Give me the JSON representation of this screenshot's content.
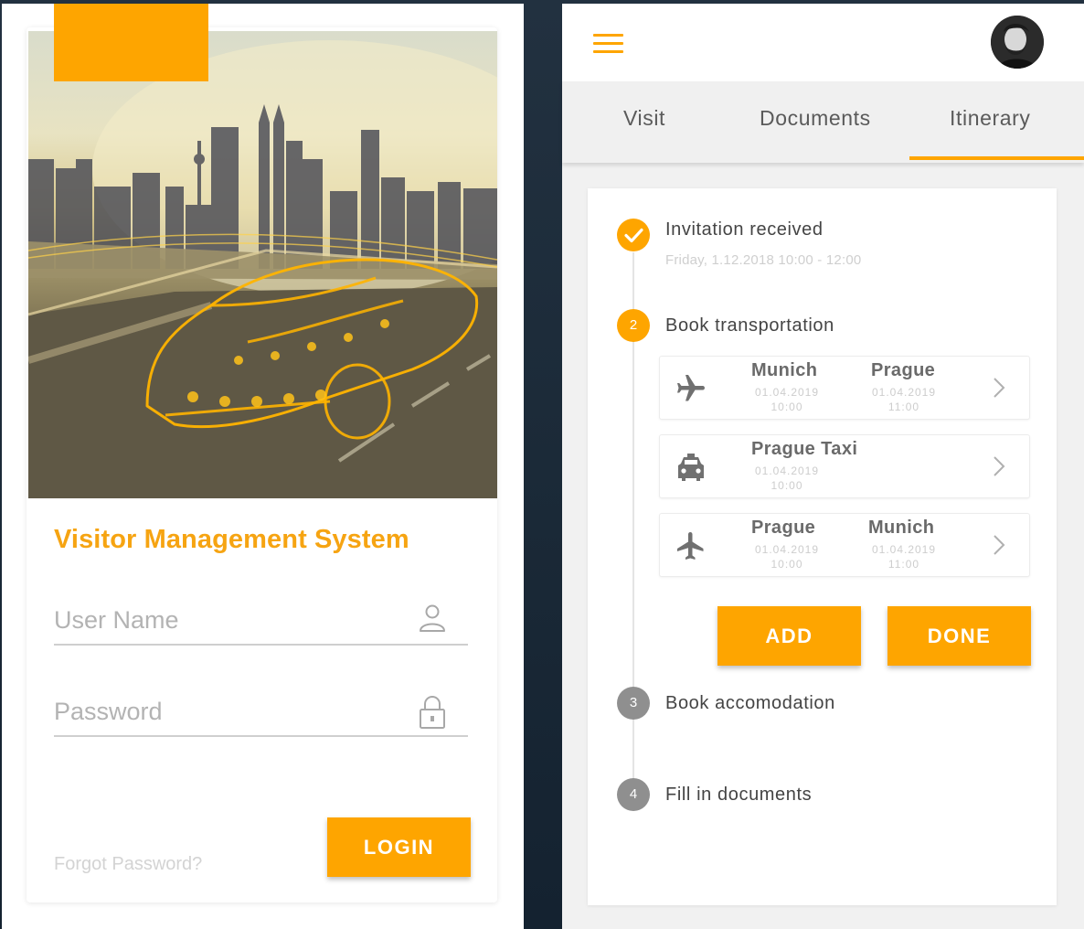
{
  "login": {
    "title": "Visitor Management System",
    "username": {
      "placeholder": "User Name",
      "value": "",
      "icon": "user-icon"
    },
    "password": {
      "placeholder": "Password",
      "value": "",
      "icon": "lock-icon"
    },
    "forgot_label": "Forgot Password?",
    "login_label": "LOGIN",
    "accent_color": "#fea500"
  },
  "itinerary": {
    "menu_icon": "hamburger-menu-icon",
    "avatar": "user-avatar",
    "tabs": [
      {
        "label": "Visit"
      },
      {
        "label": "Documents"
      },
      {
        "label": "Itinerary",
        "active": true
      }
    ],
    "steps": [
      {
        "number": "",
        "status": "done",
        "label": "Invitation received",
        "subtitle": "Friday, 1.12.2018 10:00 - 12:00"
      },
      {
        "number": "2",
        "status": "active",
        "label": "Book transportation"
      },
      {
        "number": "3",
        "status": "todo",
        "label": "Book accomodation"
      },
      {
        "number": "4",
        "status": "todo",
        "label": "Fill in documents"
      }
    ],
    "trips": [
      {
        "icon": "airplane-icon",
        "from": "Munich",
        "from_date": "01.04.2019",
        "from_time": "10:00",
        "to": "Prague",
        "to_date": "01.04.2019",
        "to_time": "11:00"
      },
      {
        "icon": "taxi-icon",
        "from": "Prague Taxi",
        "from_date": "01.04.2019",
        "from_time": "10:00"
      },
      {
        "icon": "airplane-icon",
        "from": "Prague",
        "from_date": "01.04.2019",
        "from_time": "10:00",
        "to": "Munich",
        "to_date": "01.04.2019",
        "to_time": "11:00"
      }
    ],
    "add_label": "ADD",
    "done_label": "DONE",
    "accent_color": "#fea500"
  }
}
